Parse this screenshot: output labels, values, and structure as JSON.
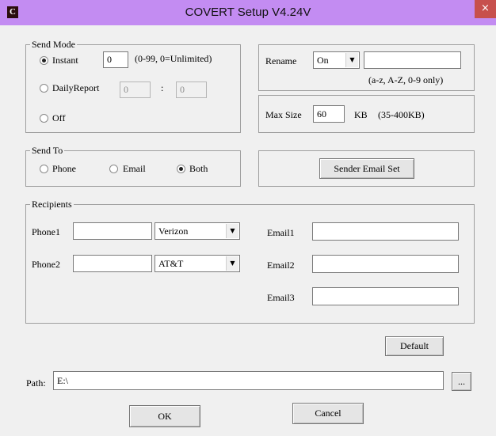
{
  "window": {
    "title": "COVERT Setup V4.24V",
    "icon": "C",
    "close": "×"
  },
  "send_mode": {
    "legend": "Send Mode",
    "instant_label": "Instant",
    "instant_value": "0",
    "instant_hint": "(0-99, 0=Unlimited)",
    "daily_label": "DailyReport",
    "daily_hour": "0",
    "daily_sep": ":",
    "daily_minute": "0",
    "off_label": "Off",
    "selected": "Instant"
  },
  "rename": {
    "label": "Rename",
    "value": "On",
    "text": "",
    "hint": "(a-z, A-Z, 0-9 only)"
  },
  "max_size": {
    "label": "Max Size",
    "value": "60",
    "unit": "KB",
    "hint": "(35-400KB)"
  },
  "send_to": {
    "legend": "Send To",
    "phone": "Phone",
    "email": "Email",
    "both": "Both",
    "selected": "Both"
  },
  "sender_email_set": "Sender Email Set",
  "recipients": {
    "legend": "Recipients",
    "phone1_label": "Phone1",
    "phone1_value": "",
    "phone1_carrier": "Verizon",
    "phone2_label": "Phone2",
    "phone2_value": "",
    "phone2_carrier": "AT&T",
    "email1_label": "Email1",
    "email1_value": "",
    "email2_label": "Email2",
    "email2_value": "",
    "email3_label": "Email3",
    "email3_value": ""
  },
  "default_button": "Default",
  "path": {
    "label": "Path:",
    "value": "E:\\",
    "browse": "..."
  },
  "ok_button": "OK",
  "cancel_button": "Cancel"
}
